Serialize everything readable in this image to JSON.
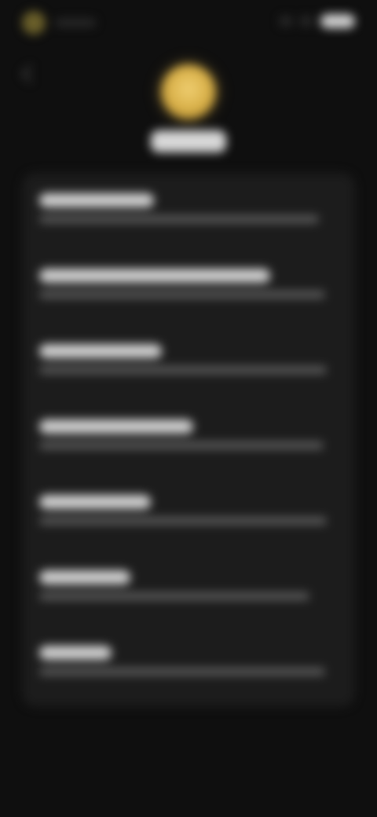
{
  "status_bar": {
    "left_icon": "app-icon",
    "right_icons": [
      "signal-icon",
      "wifi-icon",
      "battery-icon"
    ]
  },
  "header": {
    "back_icon": "chevron-left-icon",
    "avatar_color": "#d6ad45",
    "name": ""
  },
  "list": {
    "items": [
      {
        "title": "",
        "subtitle": ""
      },
      {
        "title": "",
        "subtitle": ""
      },
      {
        "title": "",
        "subtitle": ""
      },
      {
        "title": "",
        "subtitle": ""
      },
      {
        "title": "",
        "subtitle": ""
      },
      {
        "title": "",
        "subtitle": ""
      },
      {
        "title": "",
        "subtitle": ""
      }
    ]
  },
  "colors": {
    "background": "#0f0f0f",
    "card": "#1c1c1c",
    "accent": "#d6ad45"
  }
}
